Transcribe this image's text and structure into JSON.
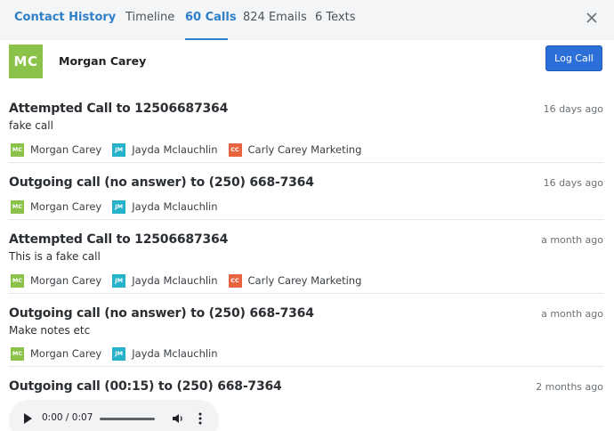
{
  "header": {
    "title": "Contact History",
    "tabs": [
      {
        "label": "Timeline"
      },
      {
        "label": "60 Calls"
      },
      {
        "label": "824 Emails"
      },
      {
        "label": "6 Texts"
      }
    ],
    "active_tab": "60 Calls"
  },
  "contact": {
    "initials": "MC",
    "name": "Morgan Carey",
    "log_button": "Log Call"
  },
  "colors": {
    "accent": "#2e7fc9",
    "button": "#2d6fd8",
    "mc_badge": "#8bc34a",
    "jm_badge": "#26b3c9",
    "cc_badge": "#e8643f"
  },
  "calls": [
    {
      "title": "Attempted Call to 12506687364",
      "time": "16 days ago",
      "note": "fake call",
      "participants": [
        {
          "initials": "MC",
          "name": "Morgan Carey"
        },
        {
          "initials": "JM",
          "name": "Jayda Mclauchlin"
        },
        {
          "initials": "CC",
          "name": "Carly Carey Marketing"
        }
      ]
    },
    {
      "title": "Outgoing call (no answer) to (250) 668-7364",
      "time": "16 days ago",
      "participants": [
        {
          "initials": "MC",
          "name": "Morgan Carey"
        },
        {
          "initials": "JM",
          "name": "Jayda Mclauchlin"
        }
      ]
    },
    {
      "title": "Attempted Call to 12506687364",
      "time": "a month ago",
      "note": "This is a fake call",
      "participants": [
        {
          "initials": "MC",
          "name": "Morgan Carey"
        },
        {
          "initials": "JM",
          "name": "Jayda Mclauchlin"
        },
        {
          "initials": "CC",
          "name": "Carly Carey Marketing"
        }
      ]
    },
    {
      "title": "Outgoing call (no answer) to (250) 668-7364",
      "time": "a month ago",
      "note": "Make notes etc",
      "participants": [
        {
          "initials": "MC",
          "name": "Morgan Carey"
        },
        {
          "initials": "JM",
          "name": "Jayda Mclauchlin"
        }
      ]
    },
    {
      "title": "Outgoing call (00:15) to (250) 668-7364",
      "time": "2 months ago",
      "audio_time": "0:00 / 0:07"
    }
  ]
}
